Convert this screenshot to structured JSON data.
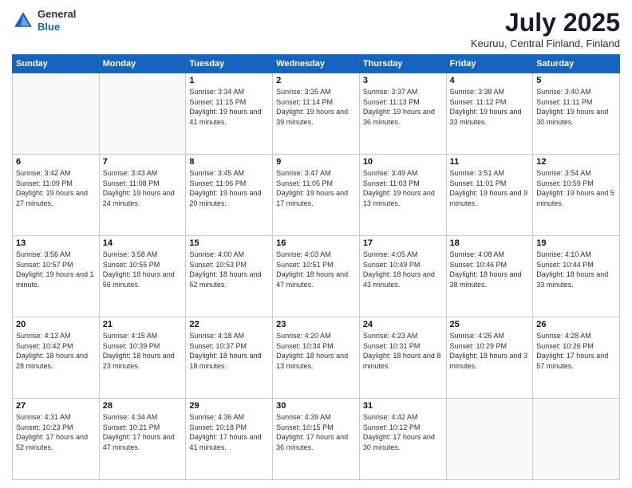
{
  "header": {
    "logo": {
      "line1": "General",
      "line2": "Blue"
    },
    "title": "July 2025",
    "location": "Keuruu, Central Finland, Finland"
  },
  "days_of_week": [
    "Sunday",
    "Monday",
    "Tuesday",
    "Wednesday",
    "Thursday",
    "Friday",
    "Saturday"
  ],
  "weeks": [
    [
      {
        "day": "",
        "info": ""
      },
      {
        "day": "",
        "info": ""
      },
      {
        "day": "1",
        "sunrise": "3:34 AM",
        "sunset": "11:15 PM",
        "daylight": "19 hours and 41 minutes."
      },
      {
        "day": "2",
        "sunrise": "3:35 AM",
        "sunset": "11:14 PM",
        "daylight": "19 hours and 39 minutes."
      },
      {
        "day": "3",
        "sunrise": "3:37 AM",
        "sunset": "11:13 PM",
        "daylight": "19 hours and 36 minutes."
      },
      {
        "day": "4",
        "sunrise": "3:38 AM",
        "sunset": "11:12 PM",
        "daylight": "19 hours and 33 minutes."
      },
      {
        "day": "5",
        "sunrise": "3:40 AM",
        "sunset": "11:11 PM",
        "daylight": "19 hours and 30 minutes."
      }
    ],
    [
      {
        "day": "6",
        "sunrise": "3:42 AM",
        "sunset": "11:09 PM",
        "daylight": "19 hours and 27 minutes."
      },
      {
        "day": "7",
        "sunrise": "3:43 AM",
        "sunset": "11:08 PM",
        "daylight": "19 hours and 24 minutes."
      },
      {
        "day": "8",
        "sunrise": "3:45 AM",
        "sunset": "11:06 PM",
        "daylight": "19 hours and 20 minutes."
      },
      {
        "day": "9",
        "sunrise": "3:47 AM",
        "sunset": "11:05 PM",
        "daylight": "19 hours and 17 minutes."
      },
      {
        "day": "10",
        "sunrise": "3:49 AM",
        "sunset": "11:03 PM",
        "daylight": "19 hours and 13 minutes."
      },
      {
        "day": "11",
        "sunrise": "3:51 AM",
        "sunset": "11:01 PM",
        "daylight": "19 hours and 9 minutes."
      },
      {
        "day": "12",
        "sunrise": "3:54 AM",
        "sunset": "10:59 PM",
        "daylight": "19 hours and 5 minutes."
      }
    ],
    [
      {
        "day": "13",
        "sunrise": "3:56 AM",
        "sunset": "10:57 PM",
        "daylight": "19 hours and 1 minute."
      },
      {
        "day": "14",
        "sunrise": "3:58 AM",
        "sunset": "10:55 PM",
        "daylight": "18 hours and 56 minutes."
      },
      {
        "day": "15",
        "sunrise": "4:00 AM",
        "sunset": "10:53 PM",
        "daylight": "18 hours and 52 minutes."
      },
      {
        "day": "16",
        "sunrise": "4:03 AM",
        "sunset": "10:51 PM",
        "daylight": "18 hours and 47 minutes."
      },
      {
        "day": "17",
        "sunrise": "4:05 AM",
        "sunset": "10:49 PM",
        "daylight": "18 hours and 43 minutes."
      },
      {
        "day": "18",
        "sunrise": "4:08 AM",
        "sunset": "10:46 PM",
        "daylight": "18 hours and 38 minutes."
      },
      {
        "day": "19",
        "sunrise": "4:10 AM",
        "sunset": "10:44 PM",
        "daylight": "18 hours and 33 minutes."
      }
    ],
    [
      {
        "day": "20",
        "sunrise": "4:13 AM",
        "sunset": "10:42 PM",
        "daylight": "18 hours and 28 minutes."
      },
      {
        "day": "21",
        "sunrise": "4:15 AM",
        "sunset": "10:39 PM",
        "daylight": "18 hours and 23 minutes."
      },
      {
        "day": "22",
        "sunrise": "4:18 AM",
        "sunset": "10:37 PM",
        "daylight": "18 hours and 18 minutes."
      },
      {
        "day": "23",
        "sunrise": "4:20 AM",
        "sunset": "10:34 PM",
        "daylight": "18 hours and 13 minutes."
      },
      {
        "day": "24",
        "sunrise": "4:23 AM",
        "sunset": "10:31 PM",
        "daylight": "18 hours and 8 minutes."
      },
      {
        "day": "25",
        "sunrise": "4:26 AM",
        "sunset": "10:29 PM",
        "daylight": "18 hours and 3 minutes."
      },
      {
        "day": "26",
        "sunrise": "4:28 AM",
        "sunset": "10:26 PM",
        "daylight": "17 hours and 57 minutes."
      }
    ],
    [
      {
        "day": "27",
        "sunrise": "4:31 AM",
        "sunset": "10:23 PM",
        "daylight": "17 hours and 52 minutes."
      },
      {
        "day": "28",
        "sunrise": "4:34 AM",
        "sunset": "10:21 PM",
        "daylight": "17 hours and 47 minutes."
      },
      {
        "day": "29",
        "sunrise": "4:36 AM",
        "sunset": "10:18 PM",
        "daylight": "17 hours and 41 minutes."
      },
      {
        "day": "30",
        "sunrise": "4:39 AM",
        "sunset": "10:15 PM",
        "daylight": "17 hours and 36 minutes."
      },
      {
        "day": "31",
        "sunrise": "4:42 AM",
        "sunset": "10:12 PM",
        "daylight": "17 hours and 30 minutes."
      },
      {
        "day": "",
        "info": ""
      },
      {
        "day": "",
        "info": ""
      }
    ]
  ]
}
